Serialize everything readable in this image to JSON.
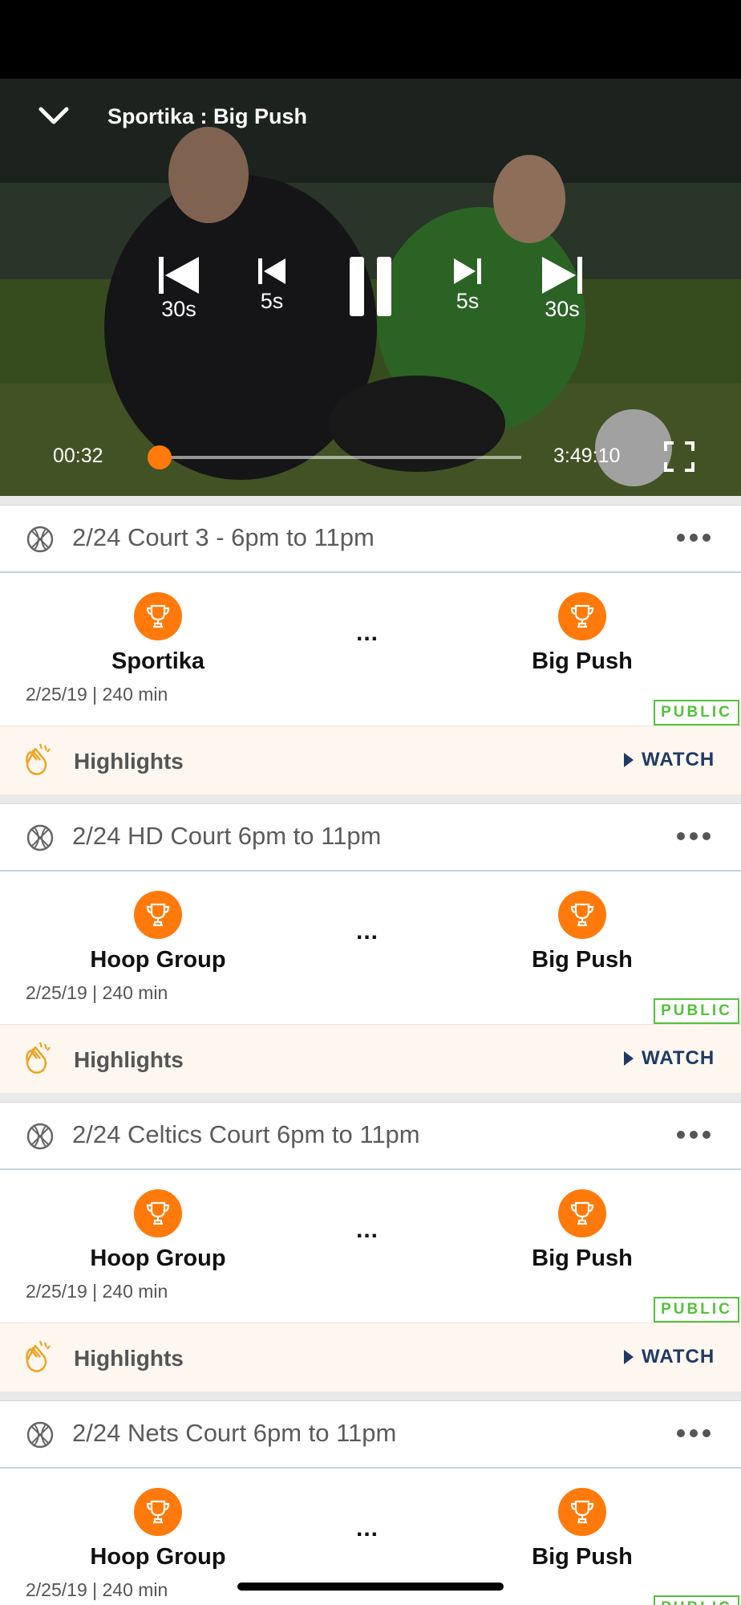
{
  "player": {
    "title": "Sportika : Big Push",
    "controls": {
      "back30_label": "30s",
      "back5_label": "5s",
      "fwd5_label": "5s",
      "fwd30_label": "30s"
    },
    "current_time": "00:32",
    "total_time": "3:49:10",
    "progress_fraction": 0.0023,
    "accent_color": "#ff7a0a"
  },
  "games": [
    {
      "title": "2/24 Court 3 - 6pm to 11pm",
      "team_left": "Sportika",
      "team_right": "Big Push",
      "vs": "...",
      "meta": "2/25/19 | 240 min",
      "badge": "PUBLIC",
      "highlights_label": "Highlights",
      "watch_label": "WATCH"
    },
    {
      "title": "2/24 HD Court 6pm to 11pm",
      "team_left": "Hoop Group",
      "team_right": "Big Push",
      "vs": "...",
      "meta": "2/25/19 | 240 min",
      "badge": "PUBLIC",
      "highlights_label": "Highlights",
      "watch_label": "WATCH"
    },
    {
      "title": "2/24 Celtics Court 6pm to 11pm",
      "team_left": "Hoop Group",
      "team_right": "Big Push",
      "vs": "...",
      "meta": "2/25/19 | 240 min",
      "badge": "PUBLIC",
      "highlights_label": "Highlights",
      "watch_label": "WATCH"
    },
    {
      "title": "2/24 Nets Court 6pm to 11pm",
      "team_left": "Hoop Group",
      "team_right": "Big Push",
      "vs": "...",
      "meta": "2/25/19 | 240 min",
      "badge": "PUBLIC"
    }
  ],
  "colors": {
    "accent": "#ff7a0a",
    "public_badge": "#52c23a",
    "watch_link": "#1f3a66",
    "highlights_bg": "#fdf7ef"
  }
}
